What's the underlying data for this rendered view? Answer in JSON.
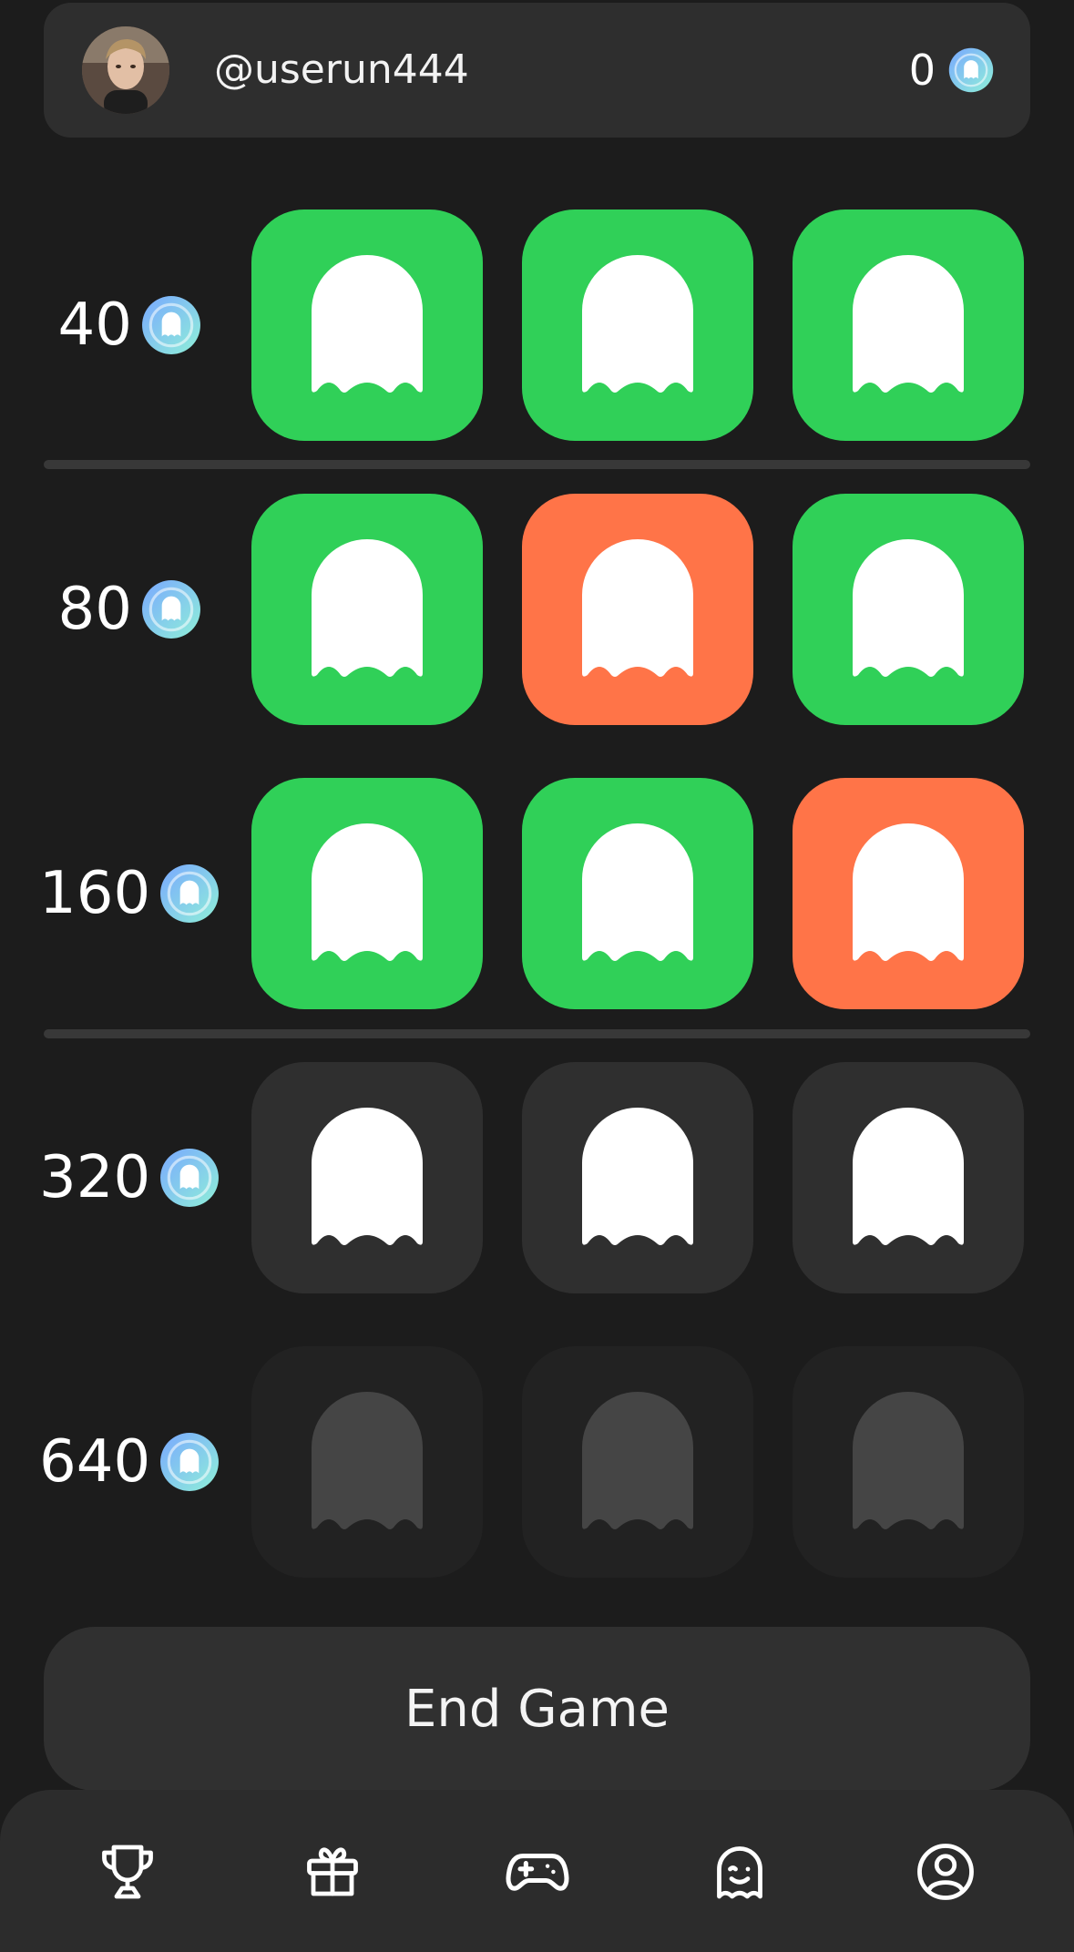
{
  "header": {
    "username": "@userun444",
    "balance": "0",
    "avatar_icon": "user-avatar-photo"
  },
  "rows": [
    {
      "value": "40",
      "tiles": [
        "win",
        "win",
        "win"
      ]
    },
    {
      "value": "80",
      "tiles": [
        "win",
        "lose",
        "win"
      ]
    },
    {
      "value": "160",
      "tiles": [
        "win",
        "win",
        "lose"
      ]
    },
    {
      "value": "320",
      "tiles": [
        "active",
        "active",
        "active"
      ]
    },
    {
      "value": "640",
      "tiles": [
        "locked",
        "locked",
        "locked"
      ]
    }
  ],
  "icons": {
    "tile": "ghost-icon",
    "coin": "ghost-coin-icon"
  },
  "end_game": {
    "label": "End Game"
  },
  "tabbar": {
    "tabs": [
      "trophy-icon",
      "gift-icon",
      "gamepad-icon",
      "ghost-face-icon",
      "profile-icon"
    ]
  },
  "colors": {
    "background": "#1c1c1c",
    "panel": "#2e2e2e",
    "win": "#30d058",
    "lose": "#ff7448",
    "active_tile": "#2f2f2f",
    "locked_tile": "#222222"
  }
}
